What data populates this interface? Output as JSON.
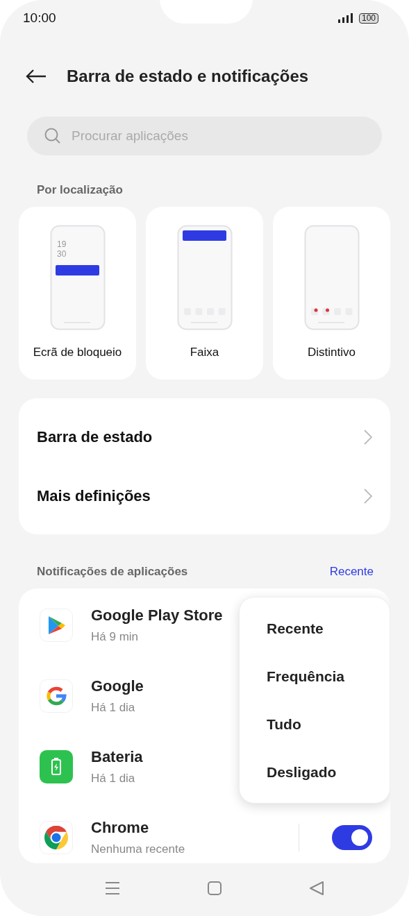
{
  "status_bar": {
    "time": "10:00",
    "battery": "100"
  },
  "header": {
    "title": "Barra de estado e notificações"
  },
  "search": {
    "placeholder": "Procurar aplicações"
  },
  "location_section": {
    "title": "Por localização",
    "options": [
      {
        "kind": "lock",
        "label": "Ecrã de bloqueio",
        "clock_lines": [
          "19",
          "30"
        ]
      },
      {
        "kind": "banner",
        "label": "Faixa"
      },
      {
        "kind": "badge",
        "label": "Distintivo"
      }
    ]
  },
  "settings": [
    {
      "label": "Barra de estado"
    },
    {
      "label": "Mais definições"
    }
  ],
  "apps_section": {
    "title": "Notificações de aplicações",
    "sort": "Recente",
    "apps": [
      {
        "kind": "play",
        "name": "Google Play Store",
        "subtitle": "Há 9 min"
      },
      {
        "kind": "google",
        "name": "Google",
        "subtitle": "Há 1 dia"
      },
      {
        "kind": "battery",
        "name": "Bateria",
        "subtitle": "Há 1 dia"
      },
      {
        "kind": "chrome",
        "name": "Chrome",
        "subtitle": "Nenhuma recente",
        "toggle": {
          "on": true
        }
      }
    ]
  },
  "sort_menu": [
    {
      "label": "Recente"
    },
    {
      "label": "Frequência"
    },
    {
      "label": "Tudo"
    },
    {
      "label": "Desligado"
    }
  ]
}
